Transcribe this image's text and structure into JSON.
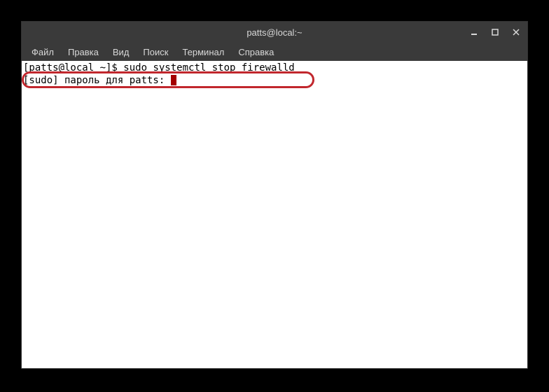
{
  "titlebar": {
    "title": "patts@local:~"
  },
  "menu": {
    "file": "Файл",
    "edit": "Правка",
    "view": "Вид",
    "search": "Поиск",
    "terminal": "Терминал",
    "help": "Справка"
  },
  "terminal": {
    "line1_prompt": "[patts@local ~]$ ",
    "line1_cmd": "sudo systemctl stop firewalld",
    "line2": "[sudo] пароль для patts: "
  },
  "colors": {
    "highlight": "#c1272d",
    "cursor": "#a40000",
    "titlebar_bg": "#3a3a3a",
    "titlebar_fg": "#d8d8d8"
  }
}
